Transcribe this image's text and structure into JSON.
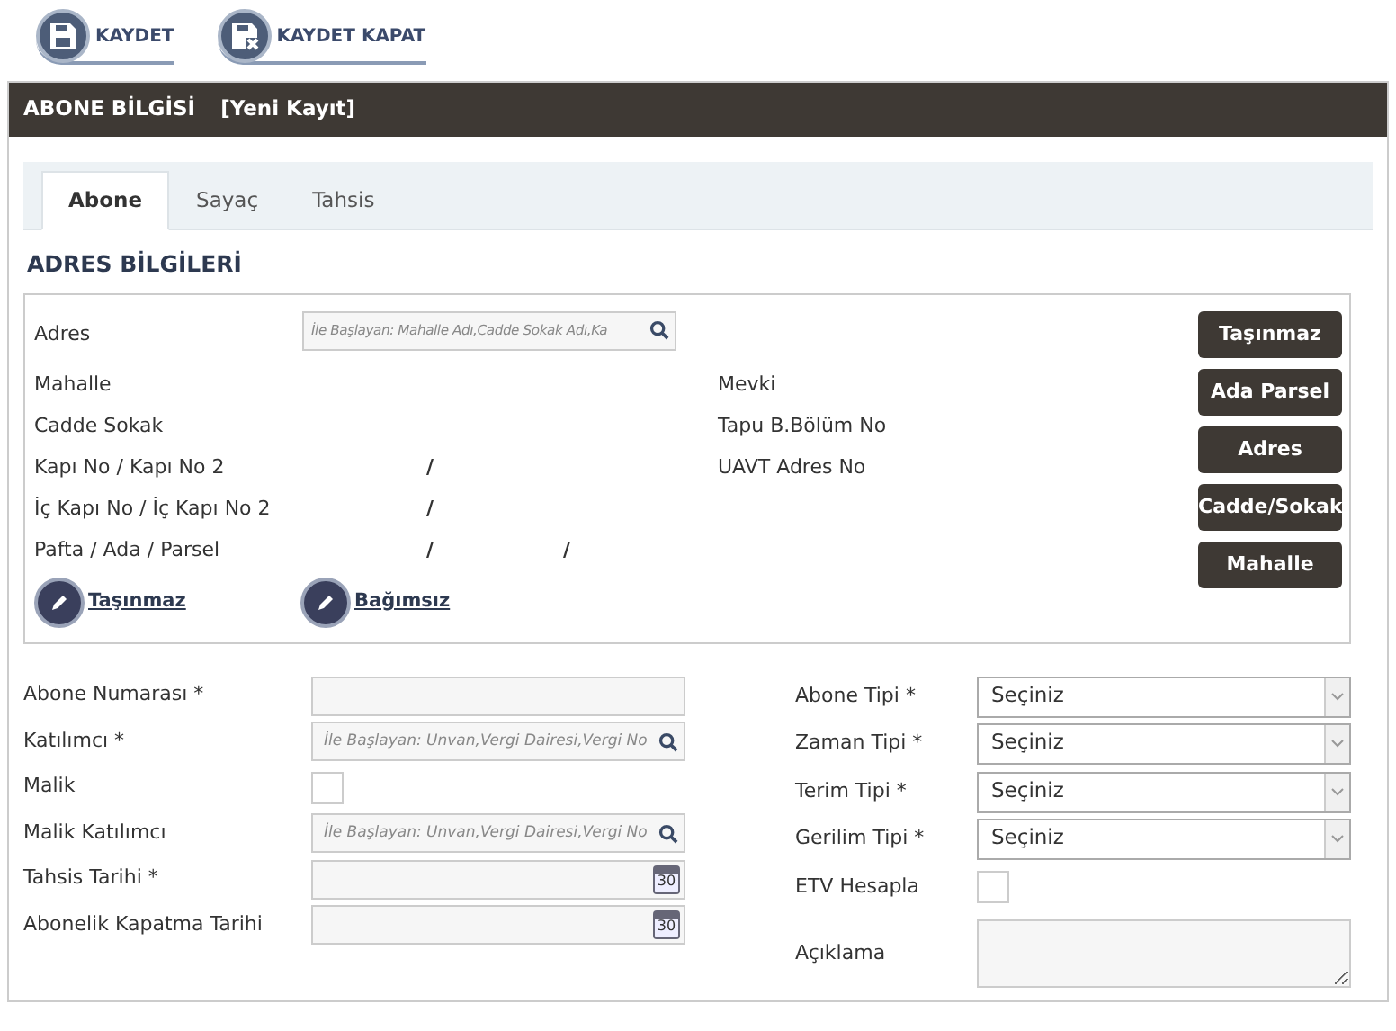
{
  "toolbar": [
    {
      "label": "KAYDET",
      "kind": "save"
    },
    {
      "label": "KAYDET KAPAT",
      "kind": "save-close"
    }
  ],
  "panel": {
    "title": "ABONE BİLGİSİ",
    "subtitle": "[Yeni Kayıt]"
  },
  "tabs": [
    {
      "label": "Abone",
      "selected": true
    },
    {
      "label": "Sayaç",
      "selected": false
    },
    {
      "label": "Tahsis",
      "selected": false
    }
  ],
  "address": {
    "heading": "ADRES BİLGİLERİ",
    "search": {
      "label": "Adres",
      "placeholder": "İle Başlayan: Mahalle Adı,Cadde Sokak Adı,Ka"
    },
    "rows": [
      {
        "label": "Mahalle"
      },
      {
        "label": "Cadde Sokak"
      },
      {
        "label": "Kapı No / Kapı No 2",
        "separators": [
          "/"
        ]
      },
      {
        "label": "İç Kapı No / İç Kapı No 2",
        "separators": [
          "/"
        ]
      },
      {
        "label": "Pafta / Ada / Parsel",
        "separators": [
          "/",
          "/"
        ]
      }
    ],
    "right_rows": [
      {
        "label": "Mevki"
      },
      {
        "label": "Tapu B.Bölüm No"
      },
      {
        "label": "UAVT Adres No"
      }
    ],
    "links": [
      "Taşınmaz",
      "Bağımsız"
    ],
    "buttons": [
      "Taşınmaz",
      "Ada Parsel",
      "Adres",
      "Cadde/Sokak",
      "Mahalle"
    ]
  },
  "left_fields": [
    {
      "label": "Abone Numarası *",
      "kind": "text"
    },
    {
      "label": "Katılımcı *",
      "kind": "search",
      "placeholder": "İle Başlayan: Unvan,Vergi Dairesi,Vergi No"
    },
    {
      "label": "Malik",
      "kind": "checkbox",
      "checked": false
    },
    {
      "label": "Malik Katılımcı",
      "kind": "search",
      "placeholder": "İle Başlayan: Unvan,Vergi Dairesi,Vergi No"
    },
    {
      "label": "Tahsis Tarihi *",
      "kind": "date",
      "icon_text": "30"
    },
    {
      "label": "Abonelik Kapatma Tarihi",
      "kind": "date",
      "icon_text": "30"
    }
  ],
  "right_fields": [
    {
      "label": "Abone Tipi *",
      "kind": "select",
      "value": "Seçiniz"
    },
    {
      "label": "Zaman Tipi *",
      "kind": "select",
      "value": "Seçiniz"
    },
    {
      "label": "Terim Tipi *",
      "kind": "select",
      "value": "Seçiniz"
    },
    {
      "label": "Gerilim Tipi *",
      "kind": "select",
      "value": "Seçiniz"
    },
    {
      "label": "ETV Hesapla",
      "kind": "checkbox",
      "checked": false
    },
    {
      "label": "Açıklama",
      "kind": "textarea"
    }
  ]
}
